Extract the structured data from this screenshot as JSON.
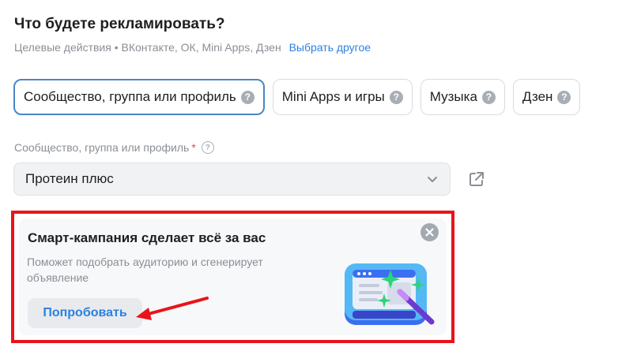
{
  "header": {
    "title": "Что будете рекламировать?",
    "subtitle": "Целевые действия • ВКонтакте, ОК, Mini Apps, Дзен",
    "change_link": "Выбрать другое"
  },
  "chips": [
    {
      "label": "Сообщество, группа или профиль",
      "active": true
    },
    {
      "label": "Mini Apps и игры",
      "active": false
    },
    {
      "label": "Музыка",
      "active": false
    },
    {
      "label": "Дзен",
      "active": false
    }
  ],
  "help_mark": "?",
  "field": {
    "label": "Сообщество, группа или профиль",
    "required_mark": "*",
    "value": "Протеин плюс"
  },
  "promo": {
    "title": "Смарт-кампания сделает всё за вас",
    "text": "Поможет подобрать аудиторию и сгенерирует объявление",
    "button": "Попробовать"
  },
  "colors": {
    "accent": "#2d81e0",
    "highlight_border": "#e8141a",
    "active_chip_border": "#4a86c8"
  }
}
